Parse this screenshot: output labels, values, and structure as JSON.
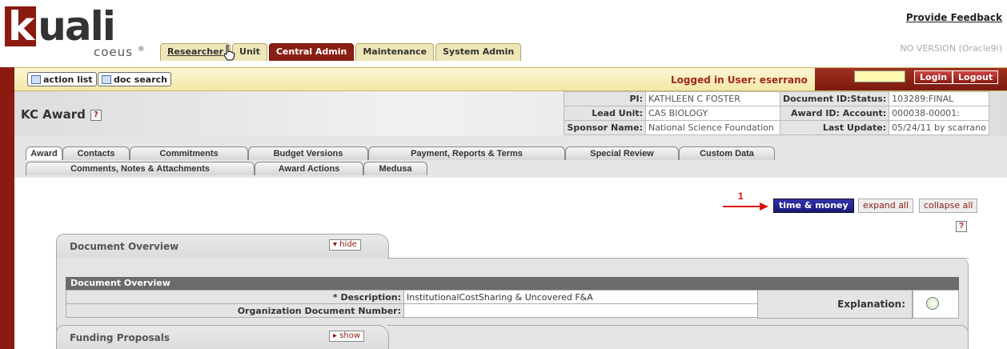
{
  "header": {
    "logo_text": "uali",
    "logo_k": "k",
    "product": "coeus",
    "product_mark": "®",
    "feedback_link": "Provide Feedback",
    "version": "NO VERSION (Oracle9i)",
    "module_tabs": [
      "Researcher",
      "Unit",
      "Central Admin",
      "Maintenance",
      "System Admin"
    ],
    "active_module": "Central Admin"
  },
  "toolbar": {
    "action_list": "action list",
    "doc_search": "doc search",
    "logged_in": "Logged in User: eserrano",
    "login": "Login",
    "logout": "Logout"
  },
  "doc_header": {
    "title": "KC Award",
    "help_glyph": "?",
    "pi_label": "PI:",
    "pi_value": "KATHLEEN C FOSTER",
    "lead_unit_label": "Lead Unit:",
    "lead_unit_value": "CAS BIOLOGY",
    "sponsor_label": "Sponsor Name:",
    "sponsor_value": "National Science Foundation",
    "doc_id_label": "Document ID:Status:",
    "doc_id_value": "103289:FINAL",
    "award_id_label": "Award ID: Account:",
    "award_id_value": "000038-00001:",
    "last_update_label": "Last Update:",
    "last_update_value": "05/24/11 by scarrano"
  },
  "doc_tabs": {
    "row1": [
      "Award",
      "Contacts",
      "Commitments",
      "Budget Versions",
      "Payment, Reports & Terms",
      "Special Review",
      "Custom Data"
    ],
    "row2": [
      "Comments, Notes & Attachments",
      "Award Actions",
      "Medusa"
    ],
    "active": "Award"
  },
  "actions": {
    "annotation_number": "1",
    "time_money": "time & money",
    "expand_all": "expand all",
    "collapse_all": "collapse all"
  },
  "document_overview": {
    "tab_label": "Document Overview",
    "hide_label": "▾ hide",
    "header": "Document Overview",
    "description_label": "* Description:",
    "description_value": "InstitutionalCostSharing & Uncovered F&A",
    "org_doc_label": "Organization Document Number:",
    "org_doc_value": "",
    "explanation_label": "Explanation:"
  },
  "funding_proposals": {
    "tab_label": "Funding Proposals",
    "show_label": "▸ show"
  }
}
